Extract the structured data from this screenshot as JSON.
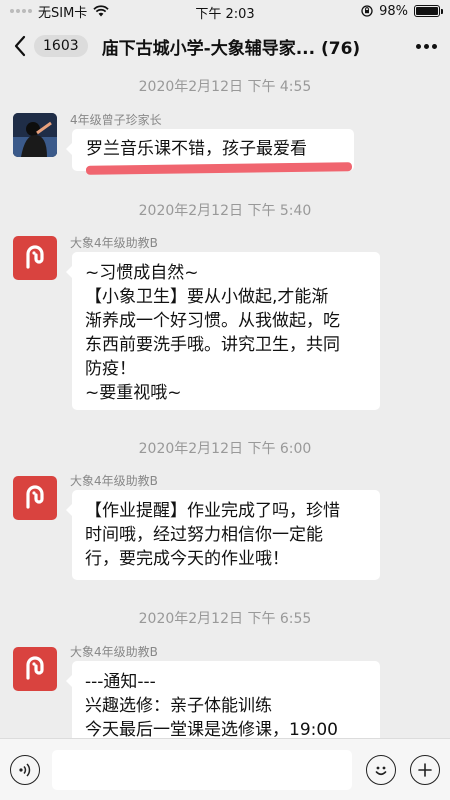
{
  "status_bar": {
    "carrier": "无SIM卡",
    "time": "下午 2:03",
    "battery": "98%",
    "battery_level": 0.98
  },
  "nav": {
    "unread_count": "1603",
    "title": "庙下古城小学-大象辅导家...",
    "member_count": "(76)"
  },
  "messages": [
    {
      "timestamp": "2020年2月12日 下午 4:55",
      "sender": "4年级曾子珍家长",
      "text": "罗兰音乐课不错，孩子最爱看"
    },
    {
      "timestamp": "2020年2月12日 下午 5:40",
      "sender": "大象4年级助教B",
      "text": "~习惯成自然~\n【小象卫生】要从小做起,才能渐\n渐养成一个好习惯。从我做起，吃\n东西前要洗手哦。讲究卫生，共同\n防疫！\n~要重视哦~"
    },
    {
      "timestamp": "2020年2月12日 下午 6:00",
      "sender": "大象4年级助教B",
      "text": "【作业提醒】作业完成了吗，珍惜\n时间哦，经过努力相信你一定能\n行，要完成今天的作业哦！"
    },
    {
      "timestamp": "2020年2月12日 下午 6:55",
      "sender": "大象4年级助教B",
      "text": "---通知---\n兴趣选修：亲子体能训练\n今天最后一堂课是选修课，19:00"
    }
  ],
  "input": {
    "placeholder": ""
  },
  "colors": {
    "brand_red": "#d9433f",
    "highlight": "#f0656f",
    "background": "#ededed"
  },
  "icons": [
    "wifi-icon",
    "rotation-lock-icon",
    "battery-icon",
    "back-icon",
    "more-icon",
    "voice-icon",
    "emoji-icon",
    "plus-icon"
  ]
}
